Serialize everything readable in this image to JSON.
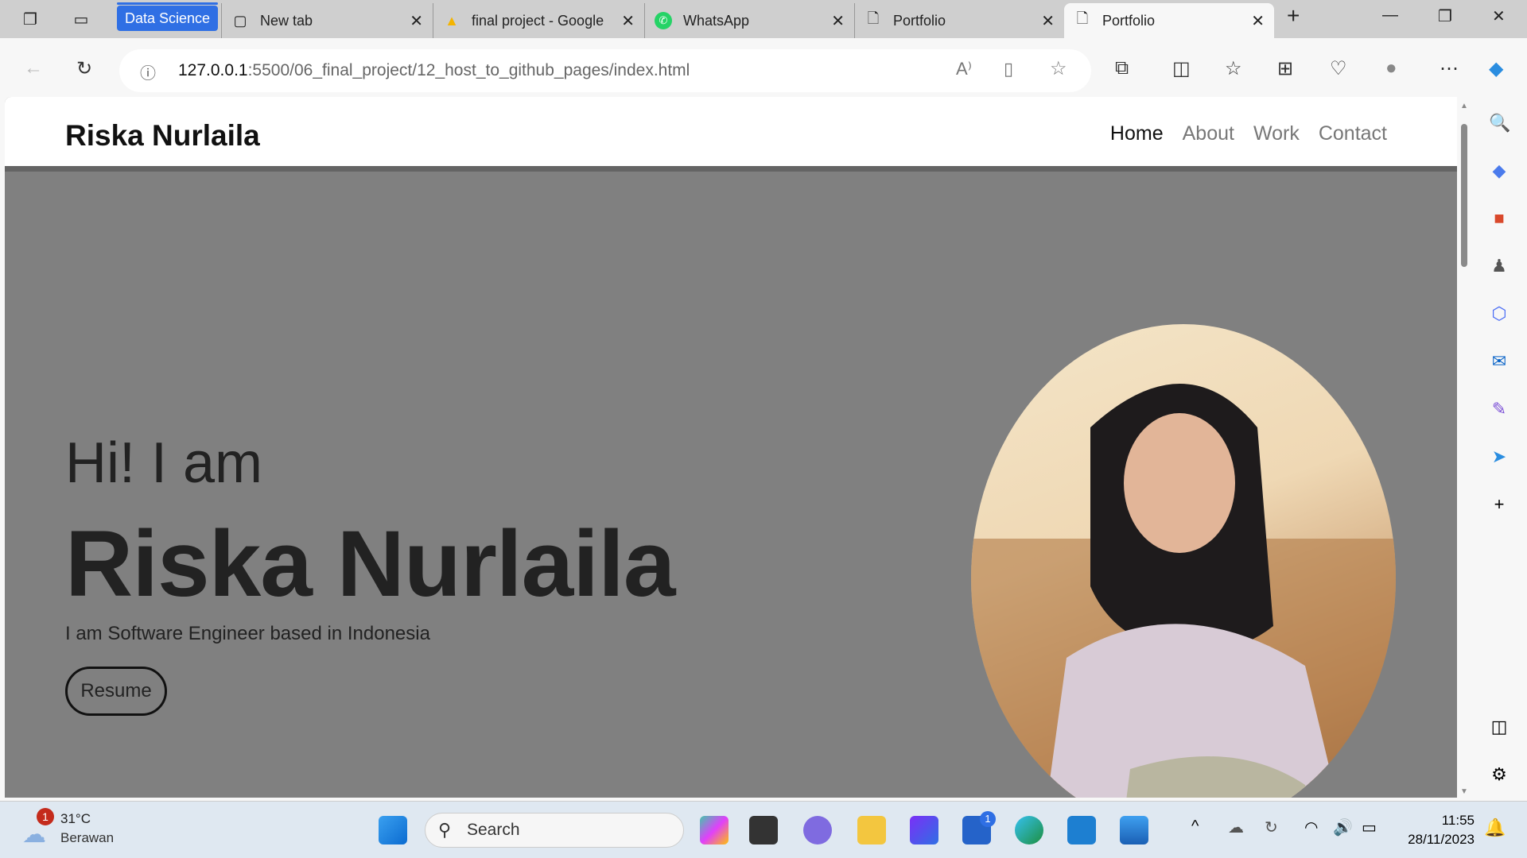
{
  "browser": {
    "tab_group": "Data Science",
    "tabs": [
      {
        "title": "New tab",
        "icon": "new-tab-icon"
      },
      {
        "title": "final project - Google",
        "icon": "google-drive-icon"
      },
      {
        "title": "WhatsApp",
        "icon": "whatsapp-icon"
      },
      {
        "title": "Portfolio",
        "icon": "page-icon"
      },
      {
        "title": "Portfolio",
        "icon": "page-icon",
        "active": true
      }
    ],
    "url_host": "127.0.0.1",
    "url_path": ":5500/06_final_project/12_host_to_github_pages/index.html"
  },
  "page": {
    "brand": "Riska Nurlaila",
    "nav": [
      "Home",
      "About",
      "Work",
      "Contact"
    ],
    "greeting": "Hi! I am",
    "name": "Riska Nurlaila",
    "tagline": "I am Software Engineer based in Indonesia",
    "resume_label": "Resume"
  },
  "taskbar": {
    "weather_temp": "31°C",
    "weather_desc": "Berawan",
    "weather_badge": "1",
    "search_placeholder": "Search",
    "store_badge": "1",
    "time": "11:55",
    "date": "28/11/2023"
  },
  "colors": {
    "hero_bg": "#808080",
    "accent": "#2f6fe4"
  }
}
